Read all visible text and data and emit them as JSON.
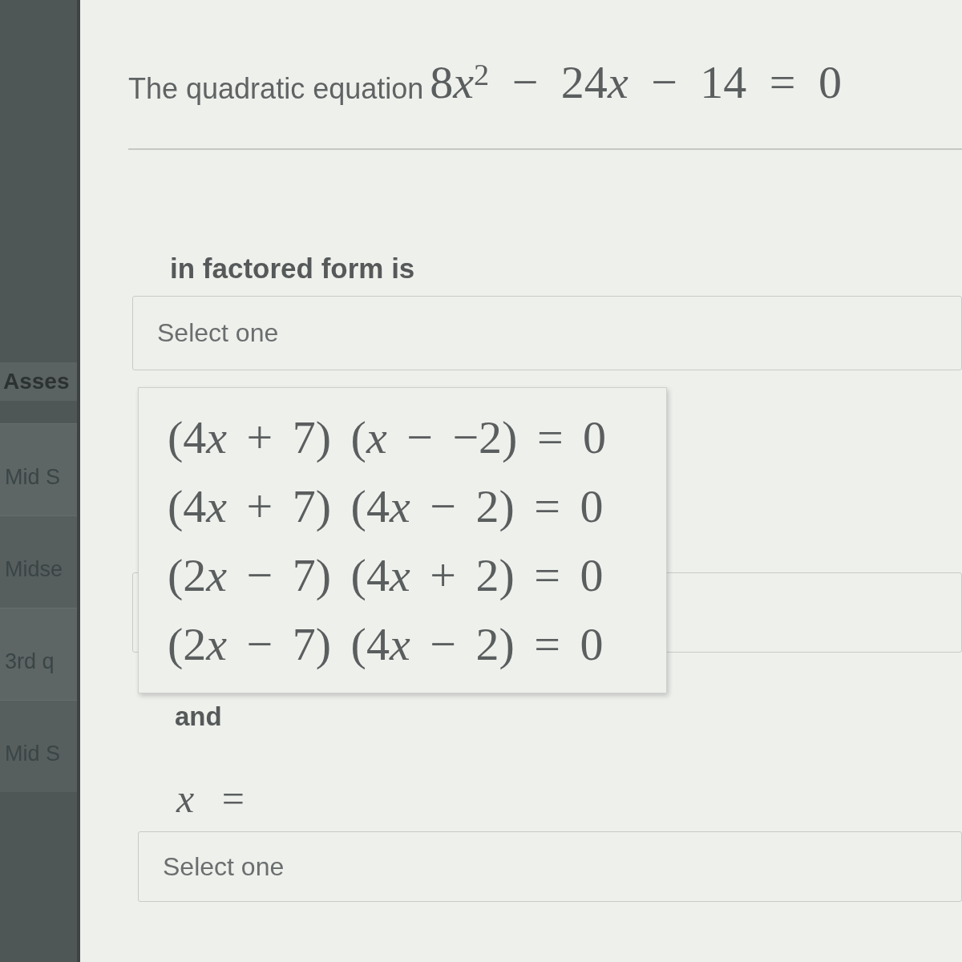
{
  "sidebar": {
    "heading": "Asses",
    "items": [
      {
        "label": "Mid S"
      },
      {
        "label": "Midse"
      },
      {
        "label": "3rd q"
      },
      {
        "label": "Mid S"
      }
    ]
  },
  "question": {
    "prompt": "The quadratic equation",
    "equation": [
      {
        "kind": "text",
        "text": "8"
      },
      {
        "kind": "var",
        "text": "x"
      },
      {
        "kind": "sup",
        "text": "2"
      },
      {
        "kind": "text",
        "text": " − 24"
      },
      {
        "kind": "var",
        "text": "x"
      },
      {
        "kind": "text",
        "text": " − 14 = 0"
      }
    ]
  },
  "factored_label": "in factored form is",
  "factored_select": {
    "placeholder": "Select one",
    "expanded": true,
    "options": [
      {
        "selected": false,
        "parts": [
          {
            "kind": "text",
            "text": "(4"
          },
          {
            "kind": "var",
            "text": "x"
          },
          {
            "kind": "text",
            "text": " + 7) ("
          },
          {
            "kind": "var",
            "text": "x"
          },
          {
            "kind": "text",
            "text": " − −2) = 0"
          }
        ]
      },
      {
        "selected": false,
        "parts": [
          {
            "kind": "text",
            "text": "(4"
          },
          {
            "kind": "var",
            "text": "x"
          },
          {
            "kind": "text",
            "text": " + 7) (4"
          },
          {
            "kind": "var",
            "text": "x"
          },
          {
            "kind": "text",
            "text": " − 2) = 0"
          }
        ]
      },
      {
        "selected": false,
        "parts": [
          {
            "kind": "text",
            "text": "(2"
          },
          {
            "kind": "var",
            "text": "x"
          },
          {
            "kind": "text",
            "text": " − 7) (4"
          },
          {
            "kind": "var",
            "text": "x"
          },
          {
            "kind": "text",
            "text": " + 2) = 0"
          }
        ]
      },
      {
        "selected": false,
        "parts": [
          {
            "kind": "text",
            "text": "(2"
          },
          {
            "kind": "var",
            "text": "x"
          },
          {
            "kind": "text",
            "text": " − 7) (4"
          },
          {
            "kind": "var",
            "text": "x"
          },
          {
            "kind": "text",
            "text": " − 2) = 0"
          }
        ]
      }
    ]
  },
  "and_label": "and",
  "root_label": [
    {
      "kind": "var",
      "text": "x"
    },
    {
      "kind": "text",
      "text": " ="
    }
  ],
  "root_select": {
    "placeholder": "Select one"
  }
}
